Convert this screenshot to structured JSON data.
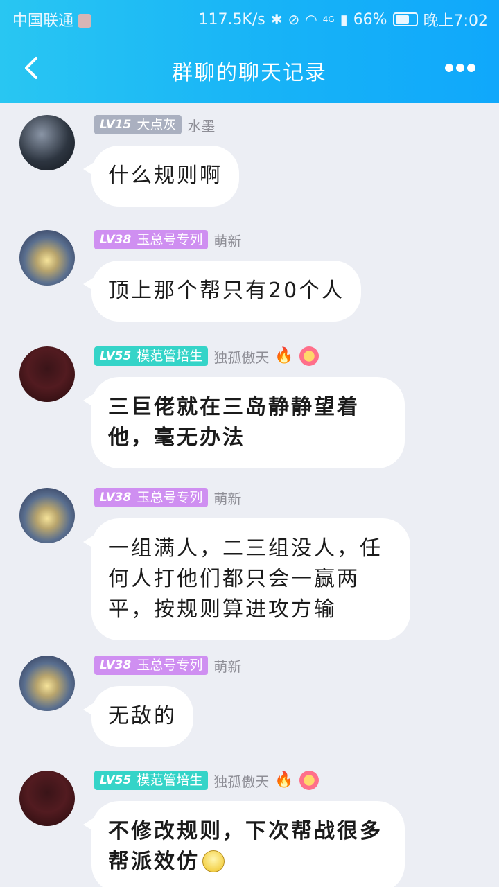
{
  "status_bar": {
    "carrier": "中国联通",
    "speed": "117.5K/s",
    "network": "4G",
    "battery": "66%",
    "time": "晚上7:02"
  },
  "nav": {
    "title": "群聊的聊天记录",
    "back_icon": "chevron-left-icon",
    "more_icon": "more-dots-icon"
  },
  "colors": {
    "header_gradient_start": "#29c6f2",
    "header_gradient_end": "#10a8fb",
    "background": "#eceef4"
  },
  "messages": [
    {
      "level": "LV15",
      "title": "大点灰",
      "nickname": "水墨",
      "text": "什么规则啊"
    },
    {
      "level": "LV38",
      "title": "玉总号专列",
      "nickname": "萌新",
      "text": "顶上那个帮只有20个人"
    },
    {
      "level": "LV55",
      "title": "模范管培生",
      "nickname": "独孤傲天",
      "text": "三巨佬就在三岛静静望着他，毫无办法"
    },
    {
      "level": "LV38",
      "title": "玉总号专列",
      "nickname": "萌新",
      "text": "一组满人，二三组没人，任何人打他们都只会一赢两平，按规则算进攻方输"
    },
    {
      "level": "LV38",
      "title": "玉总号专列",
      "nickname": "萌新",
      "text": "无敌的"
    },
    {
      "level": "LV55",
      "title": "模范管培生",
      "nickname": "独孤傲天",
      "text": "不修改规则，下次帮战很多帮派效仿"
    }
  ]
}
